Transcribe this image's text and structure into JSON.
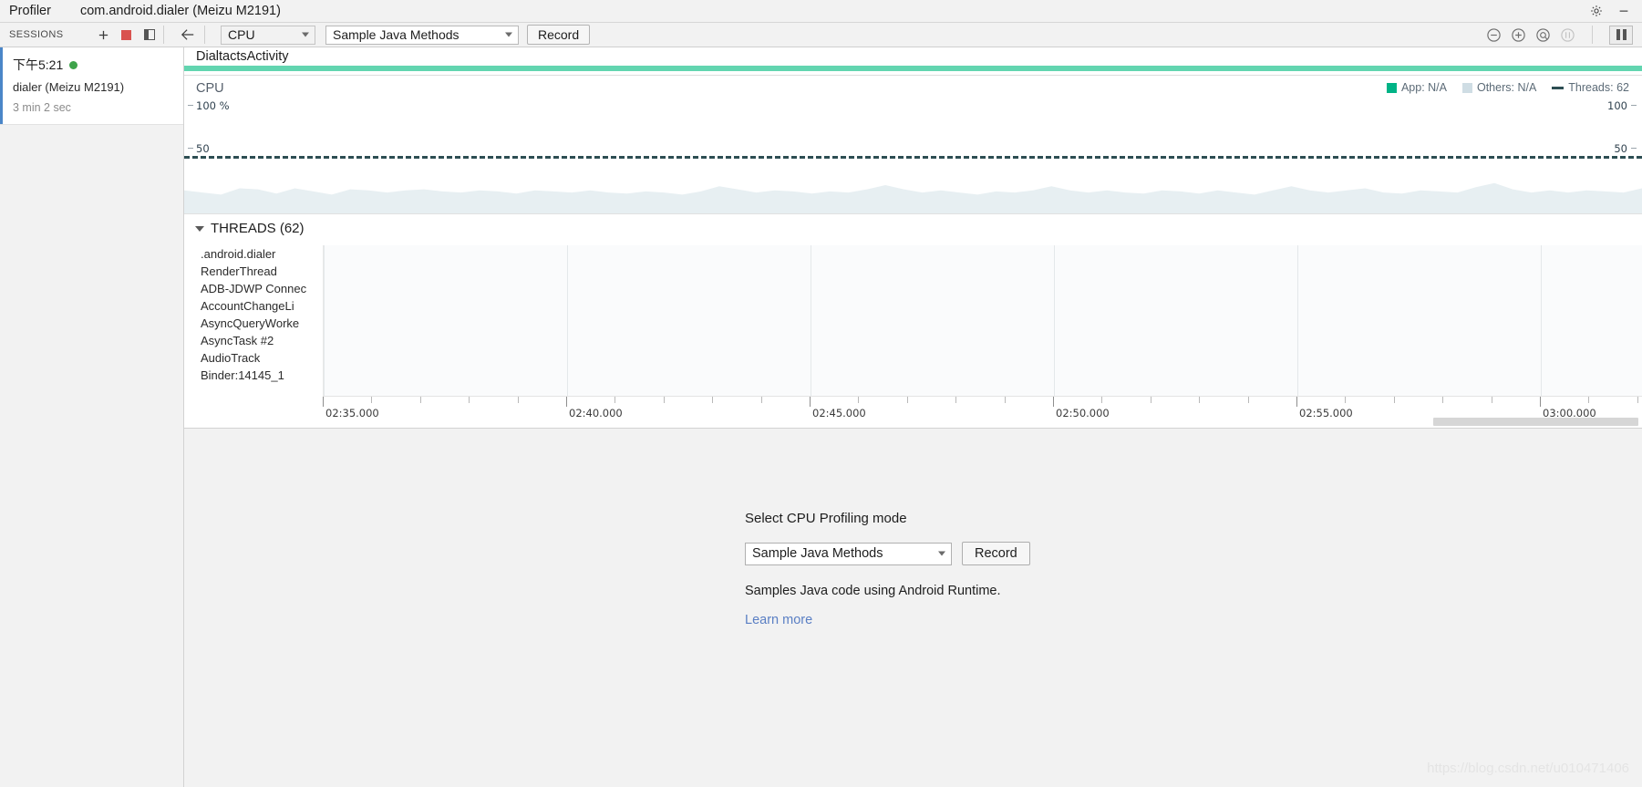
{
  "titlebar": {
    "app": "Profiler",
    "process": "com.android.dialer (Meizu M2191)",
    "settings_icon": "gear-icon",
    "minimize_icon": "minimize-icon"
  },
  "toolbar": {
    "sessions_label": "SESSIONS",
    "add_icon": "plus-icon",
    "stop_icon": "stop-record-icon",
    "panel_icon": "toggle-panel-icon",
    "back_icon": "back-arrow-icon",
    "stage_select": "CPU",
    "mode_select": "Sample Java Methods",
    "record_label": "Record",
    "zoom_out_icon": "zoom-out-icon",
    "zoom_in_icon": "zoom-in-icon",
    "zoom_reset_icon": "zoom-reset-icon",
    "frame_selection_icon": "frame-selection-icon",
    "pause_icon": "pause-icon"
  },
  "sessions": {
    "items": [
      {
        "time": "下午5:21",
        "status": "running",
        "device": "dialer (Meizu M2191)",
        "duration": "3 min 2 sec"
      }
    ]
  },
  "monitor": {
    "activity": "DialtactsActivity",
    "cpu_label": "CPU",
    "axis_left_top": "100 %",
    "axis_left_mid": "50",
    "axis_right_top": "100",
    "axis_right_mid": "50",
    "legend": [
      {
        "name": "app-usage",
        "label": "App: N/A",
        "color": "#00b386"
      },
      {
        "name": "others-usage",
        "label": "Others: N/A",
        "color": "#cfdde4"
      },
      {
        "name": "thread-count",
        "label": "Threads: 62",
        "color": "#2d4e53"
      }
    ],
    "threads_header": "THREADS (62)",
    "threads": [
      ".android.dialer",
      "RenderThread",
      "ADB-JDWP Connec",
      "AccountChangeLi",
      "AsyncQueryWorke",
      "AsyncTask #2",
      "AudioTrack",
      "Binder:14145_1"
    ],
    "time_labels": [
      "02:35.000",
      "02:40.000",
      "02:45.000",
      "02:50.000",
      "02:55.000",
      "03:00.000"
    ]
  },
  "chart_data": {
    "type": "area",
    "title": "CPU",
    "xlabel": "",
    "ylabel": "CPU %",
    "ylim": [
      0,
      100
    ],
    "y_ticks": [
      50,
      100
    ],
    "y_ticks_right": [
      50,
      100
    ],
    "right_axis_label": "Threads",
    "grid": false,
    "legend_position": "top-right",
    "x_tick_labels": [
      "02:35.000",
      "02:40.000",
      "02:45.000",
      "02:50.000",
      "02:55.000",
      "03:00.000"
    ],
    "series": [
      {
        "name": "App",
        "color": "#00b386",
        "current_value": "N/A",
        "values": []
      },
      {
        "name": "Others",
        "color": "#e7eff2",
        "current_value": "N/A",
        "values": [
          22,
          20,
          18,
          24,
          23,
          19,
          24,
          21,
          18,
          23,
          22,
          20,
          22,
          23,
          21,
          20,
          22,
          21,
          19,
          22,
          21,
          20,
          22,
          20,
          19,
          21,
          20,
          18,
          21,
          26,
          23,
          20,
          22,
          21,
          19,
          21,
          20,
          23,
          27,
          23,
          20,
          22,
          20,
          18,
          21,
          20,
          22,
          26,
          22,
          20,
          22,
          20,
          19,
          22,
          21,
          19,
          22,
          20,
          18,
          22,
          26,
          22,
          20,
          22,
          24,
          20,
          19,
          22,
          21,
          20,
          25,
          29,
          23,
          20,
          22,
          20,
          22,
          21,
          20,
          24
        ]
      },
      {
        "name": "Threads",
        "color": "#2d4e53",
        "style": "dashed-line",
        "value": 62
      }
    ]
  },
  "detail": {
    "select_title": "Select CPU Profiling mode",
    "mode_value": "Sample Java Methods",
    "record_label": "Record",
    "description": "Samples Java code using Android Runtime.",
    "learn_more": "Learn more"
  },
  "watermark": "https://blog.csdn.net/u010471406"
}
